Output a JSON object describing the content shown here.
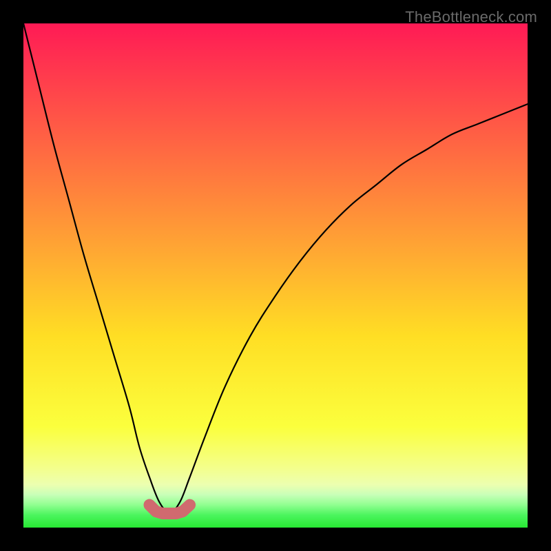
{
  "attribution": "TheBottleneck.com",
  "palette": {
    "outer_bg": "#000000",
    "line": "#000000",
    "marker": "#d06a6f",
    "green_band": "#27e833"
  },
  "chart_data": {
    "type": "line",
    "title": "",
    "xlabel": "",
    "ylabel": "",
    "xlim": [
      0,
      100
    ],
    "ylim": [
      0,
      100
    ],
    "series": [
      {
        "name": "bottleneck-curve",
        "x": [
          0,
          3,
          6,
          9,
          12,
          15,
          18,
          21,
          23,
          25,
          27,
          29,
          31,
          33,
          36,
          40,
          45,
          50,
          55,
          60,
          65,
          70,
          75,
          80,
          85,
          90,
          95,
          100
        ],
        "y": [
          100,
          88,
          76,
          65,
          54,
          44,
          34,
          24,
          16,
          10,
          5,
          3,
          5,
          10,
          18,
          28,
          38,
          46,
          53,
          59,
          64,
          68,
          72,
          75,
          78,
          80,
          82,
          84
        ]
      },
      {
        "name": "safe-zone-markers",
        "x": [
          25,
          26.3,
          27.6,
          29,
          30.3,
          31.6,
          33
        ],
        "y": [
          4.5,
          3.2,
          2.8,
          2.8,
          2.8,
          3.2,
          4.5
        ]
      }
    ],
    "gradient_stops": [
      {
        "pos": 0.0,
        "color": "#ff1a55"
      },
      {
        "pos": 0.04,
        "color": "#ff2752"
      },
      {
        "pos": 0.45,
        "color": "#ffa733"
      },
      {
        "pos": 0.62,
        "color": "#ffde24"
      },
      {
        "pos": 0.8,
        "color": "#fbff3d"
      },
      {
        "pos": 0.88,
        "color": "#f4ff8a"
      },
      {
        "pos": 0.915,
        "color": "#ecffb0"
      },
      {
        "pos": 0.935,
        "color": "#c8ffb8"
      },
      {
        "pos": 0.955,
        "color": "#90ff90"
      },
      {
        "pos": 0.975,
        "color": "#4cf55e"
      },
      {
        "pos": 1.0,
        "color": "#27e833"
      }
    ]
  }
}
